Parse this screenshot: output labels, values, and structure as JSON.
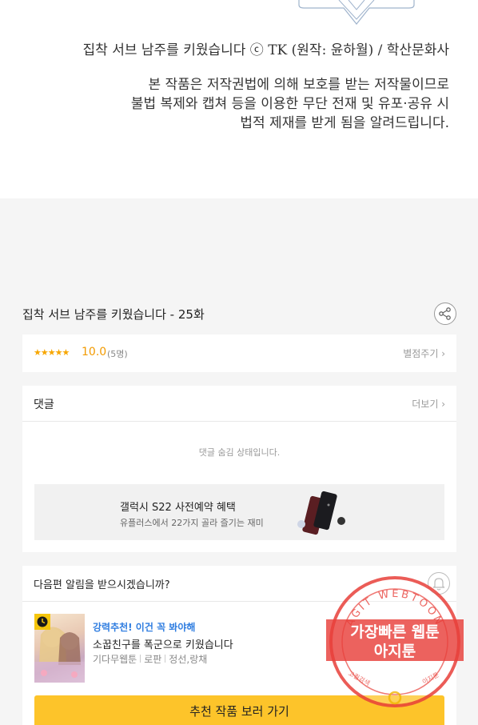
{
  "hero": {
    "credit": "집착 서브 남주를 키웠습니다 ⓒ TK (원작: 윤하월) / 학산문화사",
    "notice_lines": [
      "본 작품은 저작권법에 의해 보호를 받는 저작물이므로",
      "불법 복제와 캡쳐 등을 이용한 무단 전재 및 유포·공유 시",
      "법적 제재를 받게 됨을 알려드립니다."
    ]
  },
  "episode": {
    "title": "집착 서브 남주를 키웠습니다 - 25화",
    "share_icon": "share-icon"
  },
  "rating": {
    "stars": "★★★★★",
    "score": "10.0",
    "count": "(5명)",
    "rate_link": "별점주기 ›"
  },
  "comments": {
    "title": "댓글",
    "more": "더보기 ›",
    "hidden_message": "댓글 숨김 상태입니다."
  },
  "ad": {
    "headline": "갤럭시 S22 사전예약 혜택",
    "subline": "유플러스에서 22가지 골라 즐기는 재미"
  },
  "next_episode": {
    "question": "다음편 알림을 받으시겠습니까?",
    "bell_icon": "bell-icon"
  },
  "recommendation": {
    "tag": "강력추천! 이건 꼭 봐야해",
    "title": "소꿉친구를 폭군으로 키웠습니다",
    "meta": [
      "기다무웹툰",
      "로판",
      "정선,랑채"
    ],
    "cta": "추천 작품 보러 가기"
  },
  "stamp": {
    "ring_text": "AGIT WEBTOON",
    "line1": "가장빠른 웹툰",
    "line2": "아지툰",
    "bottom_left": "고퀄검색",
    "bottom_right": "아지툰"
  },
  "colors": {
    "accent": "#fdc42a",
    "star": "#f7a600",
    "link_blue": "#2f7de0",
    "stamp_red": "#e8403a"
  }
}
